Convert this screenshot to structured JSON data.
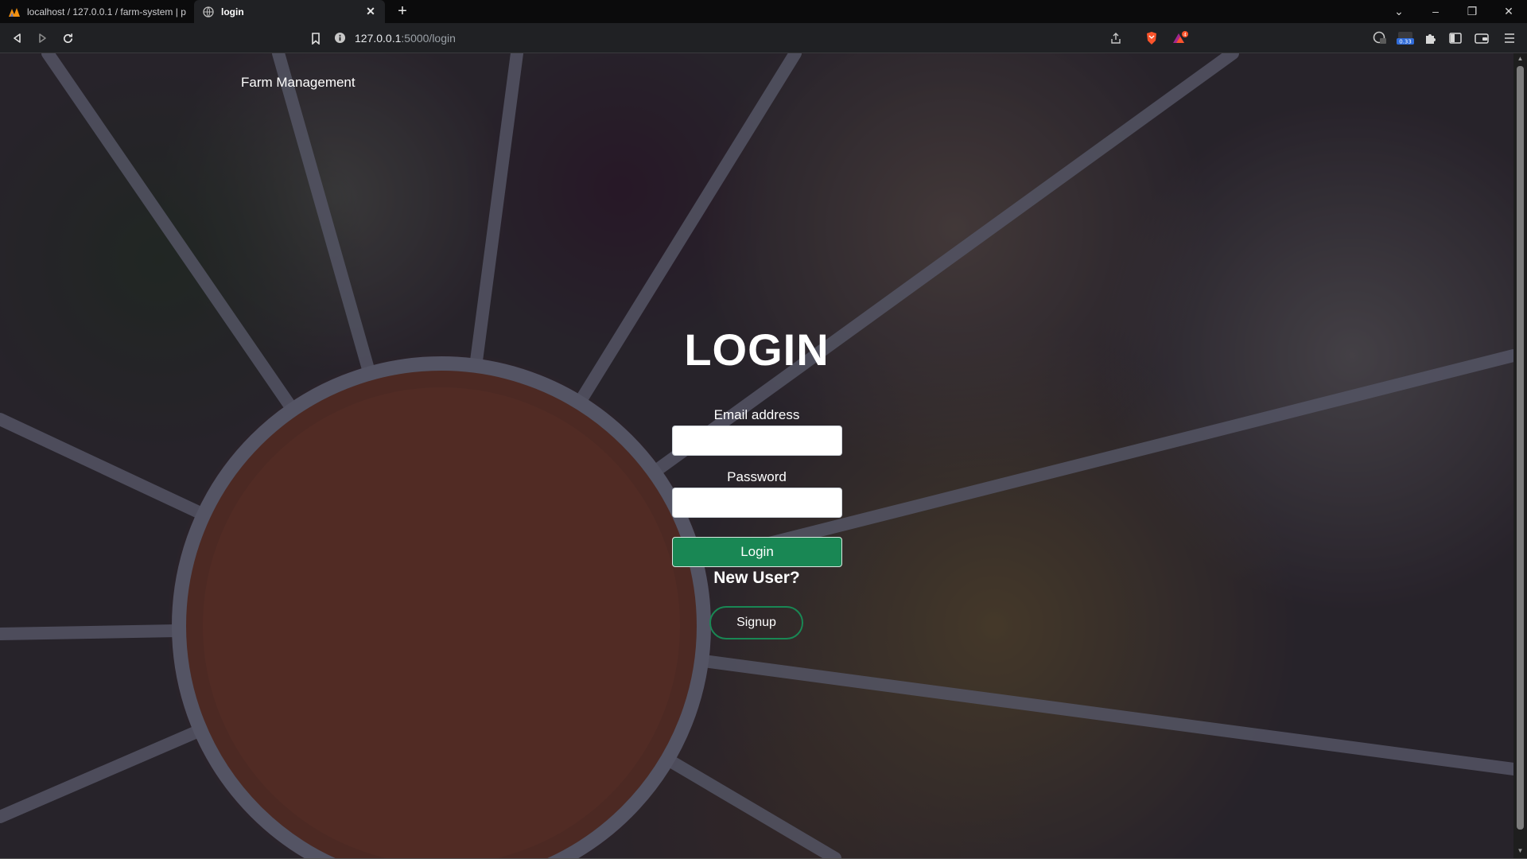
{
  "browser": {
    "tabs": [
      {
        "title": "localhost / 127.0.0.1 / farm-system | p",
        "active": false
      },
      {
        "title": "login",
        "active": true
      }
    ],
    "url_host": "127.0.0.1",
    "url_path": ":5000/login",
    "shields_count": "4",
    "ext_badge": "0.33"
  },
  "page": {
    "brand": "Farm Management",
    "title": "LOGIN",
    "email_label": "Email address",
    "email_value": "",
    "password_label": "Password",
    "password_value": "",
    "login_button": "Login",
    "new_user_text": "New User?",
    "signup_button": "Signup"
  },
  "colors": {
    "primary_green": "#198754",
    "overlay": "#121026"
  }
}
